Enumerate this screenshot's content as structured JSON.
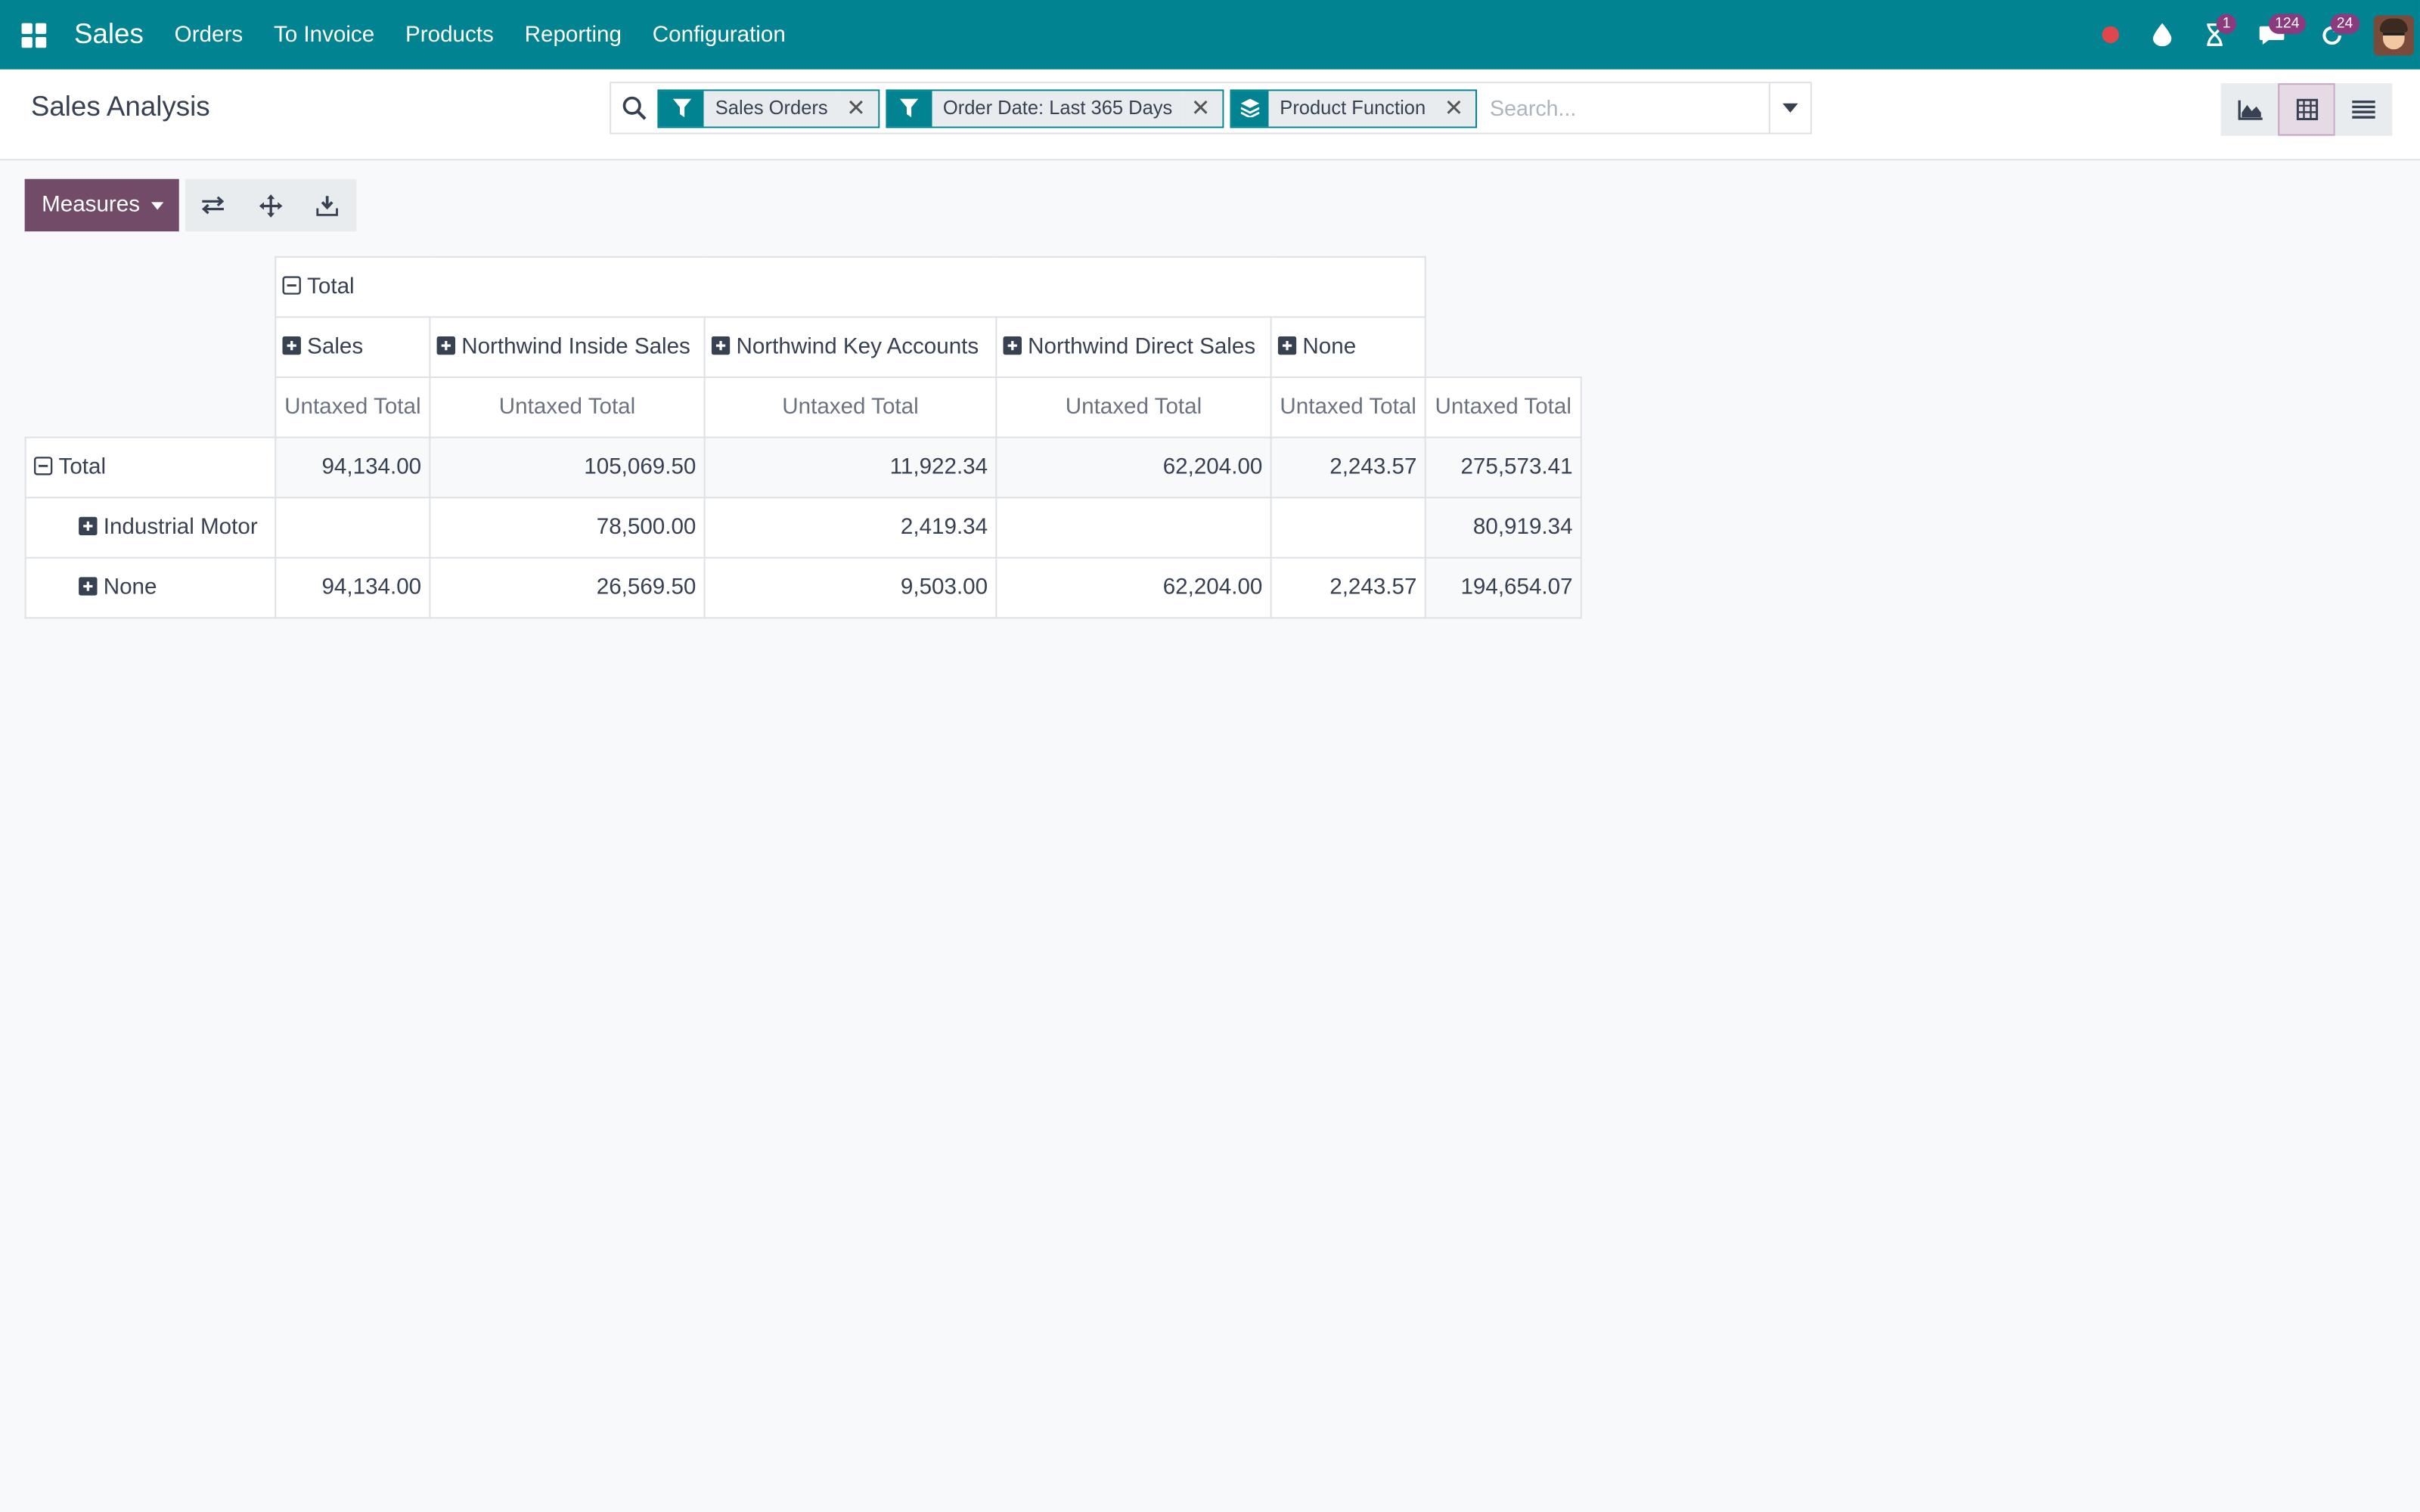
{
  "navbar": {
    "brand": "Sales",
    "menu": [
      "Orders",
      "To Invoice",
      "Products",
      "Reporting",
      "Configuration"
    ],
    "badges": {
      "activities": "1",
      "messages": "124",
      "updates": "24"
    }
  },
  "control_panel": {
    "title": "Sales Analysis",
    "facets": [
      {
        "icon": "filter-icon",
        "label": "Sales Orders"
      },
      {
        "icon": "filter-icon",
        "label": "Order Date: Last 365 Days"
      },
      {
        "icon": "group-by-icon",
        "label": "Product Function"
      }
    ],
    "search_placeholder": "Search..."
  },
  "toolbar": {
    "measures_label": "Measures"
  },
  "pivot": {
    "col_total_label": "Total",
    "columns": [
      "Sales",
      "Northwind Inside Sales",
      "Northwind Key Accounts",
      "Northwind Direct Sales",
      "None"
    ],
    "measure_label": "Untaxed Total",
    "row_total_label": "Total",
    "rows": [
      {
        "label": "Total",
        "values": [
          "94,134.00",
          "105,069.50",
          "11,922.34",
          "62,204.00",
          "2,243.57",
          "275,573.41"
        ]
      },
      {
        "label": "Industrial Motor",
        "values": [
          "",
          "78,500.00",
          "2,419.34",
          "",
          "",
          "80,919.34"
        ]
      },
      {
        "label": "None",
        "values": [
          "94,134.00",
          "26,569.50",
          "9,503.00",
          "62,204.00",
          "2,243.57",
          "194,654.07"
        ]
      }
    ]
  },
  "colors": {
    "navbar": "#018391",
    "primary": "#714b67",
    "badge": "#8b3a7e"
  }
}
